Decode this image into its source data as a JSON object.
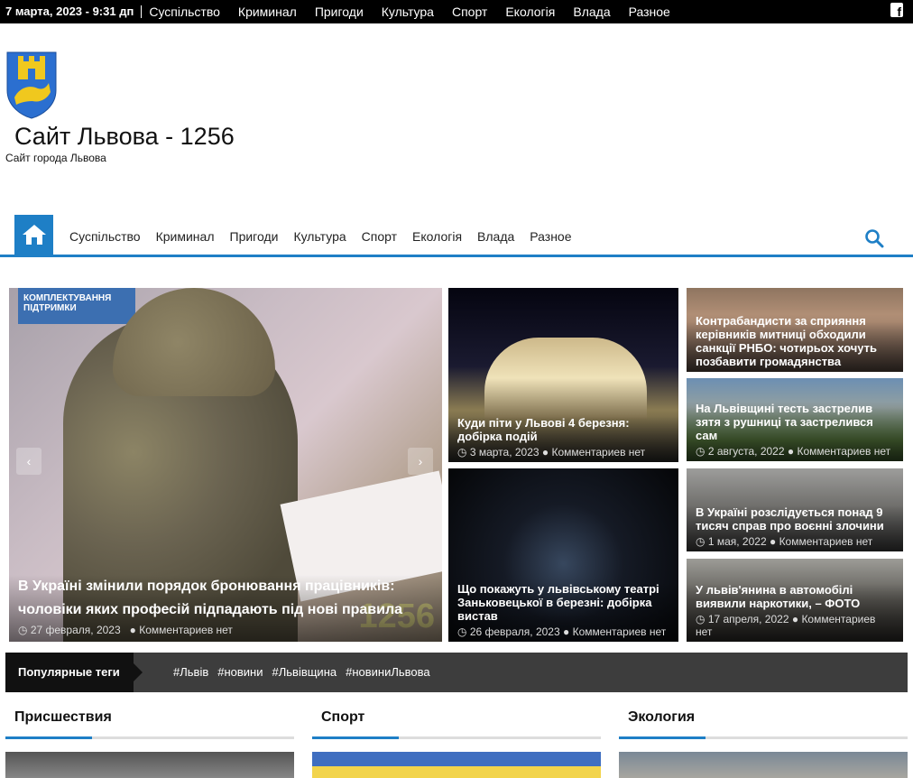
{
  "topbar": {
    "date": "7 марта, 2023 - 9:31 дп",
    "links": [
      "Суспільство",
      "Криминал",
      "Пригоди",
      "Культура",
      "Спорт",
      "Екологія",
      "Влада",
      "Разное"
    ],
    "social_icon": "facebook-icon"
  },
  "header": {
    "title": "Сайт Львова - 1256",
    "description": "Сайт города Львова",
    "logo_icon": "lviv-coat-of-arms"
  },
  "nav": {
    "home_icon": "home-icon",
    "items": [
      "Суспільство",
      "Криминал",
      "Пригоди",
      "Культура",
      "Спорт",
      "Екологія",
      "Влада",
      "Разное"
    ],
    "search_icon": "search-icon"
  },
  "slider": {
    "title": "В Україні змінили порядок бронювання працівників: чоловіки яких професій підпадають під нові правила",
    "date": "27 февраля, 2023",
    "comments": "Комментариев нет",
    "sign_text": "КОМПЛЕКТУВАННЯ ПІДТРИМКИ",
    "watermark": "1256",
    "prev": "‹",
    "next": "›"
  },
  "tiles": [
    {
      "title": "Куди піти у Львові 4 березня: добірка подій",
      "date": "3 марта, 2023",
      "comments": "Комментариев нет"
    },
    {
      "title": "Що покажуть у львівському театрі Заньковецької в березні: добірка вистав",
      "date": "26 февраля, 2023",
      "comments": "Комментариев нет"
    },
    {
      "title": "Контрабандисти за сприяння керівників митниці обходили санкції РНБО: чотирьох хочуть позбавити громадянства",
      "date": "",
      "comments": ""
    },
    {
      "title": "На Львівщині тесть застрелив зятя з рушниці та застрелився сам",
      "date": "2 августа, 2022",
      "comments": "Комментариев нет"
    },
    {
      "title": "В Україні розслідується понад 9 тисяч справ про воєнні злочини",
      "date": "1 мая, 2022",
      "comments": "Комментариев нет"
    },
    {
      "title": "У львів'янина в автомобілі виявили наркотики, – ФОТО",
      "date": "17 апреля, 2022",
      "comments": "Комментариев нет"
    }
  ],
  "tags": {
    "label": "Популярные теги",
    "items": [
      "#Львів",
      "#новини",
      "#Львівщина",
      "#новиниЛьвова"
    ]
  },
  "sections": [
    "Присшествия",
    "Спорт",
    "Экология"
  ],
  "colors": {
    "accent": "#1e7fc6",
    "topbar": "#000000",
    "tagbar": "#3d3d3d"
  }
}
